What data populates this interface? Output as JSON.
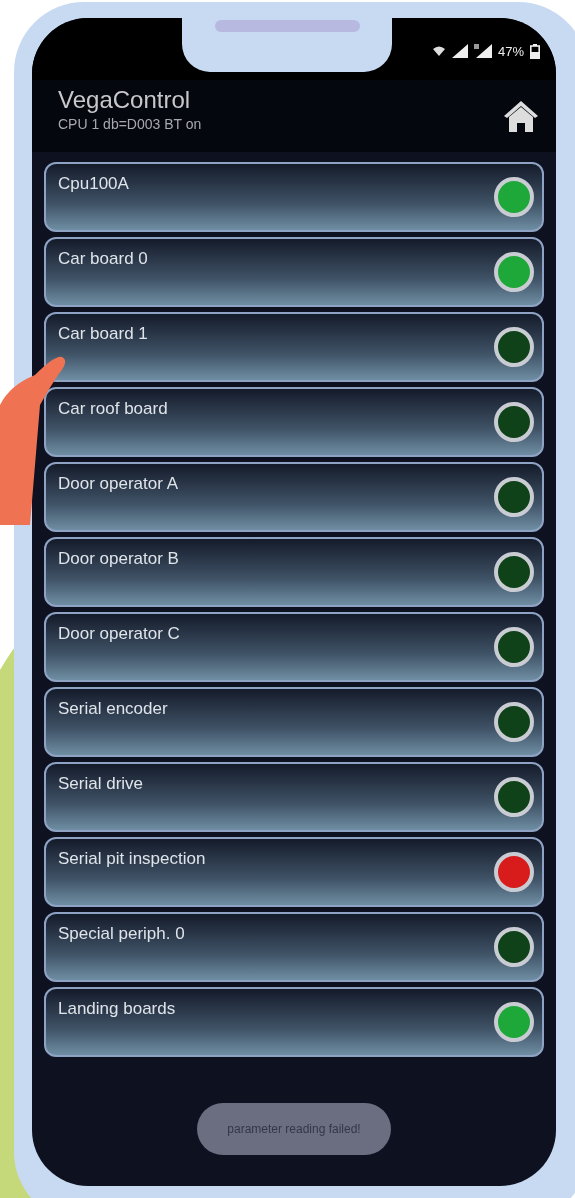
{
  "status_bar": {
    "battery": "47%"
  },
  "app_bar": {
    "title": "VegaControl",
    "subtitle": "CPU 1 db=D003 BT on"
  },
  "boards": [
    {
      "name": "Cpu100A",
      "color": "#1fa83a"
    },
    {
      "name": "Car board 0",
      "color": "#1fa83a"
    },
    {
      "name": "Car board 1",
      "color": "#0f4218"
    },
    {
      "name": "Car roof board",
      "color": "#0f4218"
    },
    {
      "name": "Door operator A",
      "color": "#0f4218"
    },
    {
      "name": "Door operator B",
      "color": "#0f4218"
    },
    {
      "name": "Door operator C",
      "color": "#0f4218"
    },
    {
      "name": "Serial encoder",
      "color": "#0f4218"
    },
    {
      "name": "Serial drive",
      "color": "#0f4218"
    },
    {
      "name": "Serial pit inspection",
      "color": "#d81c1c"
    },
    {
      "name": "Special periph. 0",
      "color": "#0f4218"
    },
    {
      "name": "Landing boards",
      "color": "#1fa83a"
    }
  ],
  "toast": "parameter reading failed!"
}
